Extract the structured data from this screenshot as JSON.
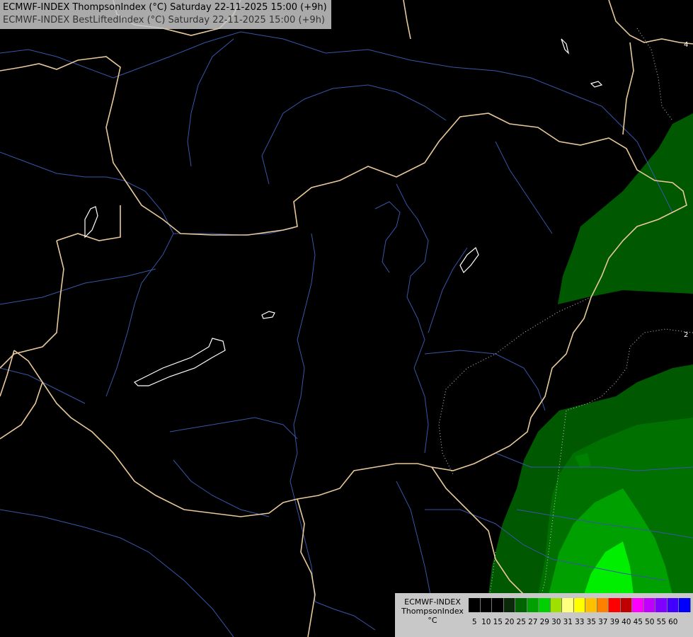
{
  "title": {
    "line1": "ECMWF-INDEX ThompsonIndex (°C) Saturday 22-11-2025 15:00 (+9h)",
    "line2": "ECMWF-INDEX BestLiftedIndex (°C) Saturday 22-11-2025 15:00 (+9h)"
  },
  "legend": {
    "line1": "ECMWF-INDEX",
    "line2": "ThompsonIndex",
    "line3": "°C",
    "colors": [
      "#000000",
      "#000000",
      "#000000",
      "#0a2a0a",
      "#006400",
      "#00a000",
      "#00d000",
      "#a0e000",
      "#ffff80",
      "#ffff00",
      "#ffc000",
      "#ff8000",
      "#ff0000",
      "#c00000",
      "#ff00ff",
      "#c000ff",
      "#8000ff",
      "#4000ff",
      "#0000ff"
    ],
    "ticks": [
      "5",
      "10",
      "15",
      "20",
      "25",
      "27",
      "29",
      "30",
      "31",
      "33",
      "35",
      "37",
      "39",
      "40",
      "45",
      "50",
      "55",
      "60"
    ]
  },
  "contour_labels": [
    "4",
    "2"
  ]
}
